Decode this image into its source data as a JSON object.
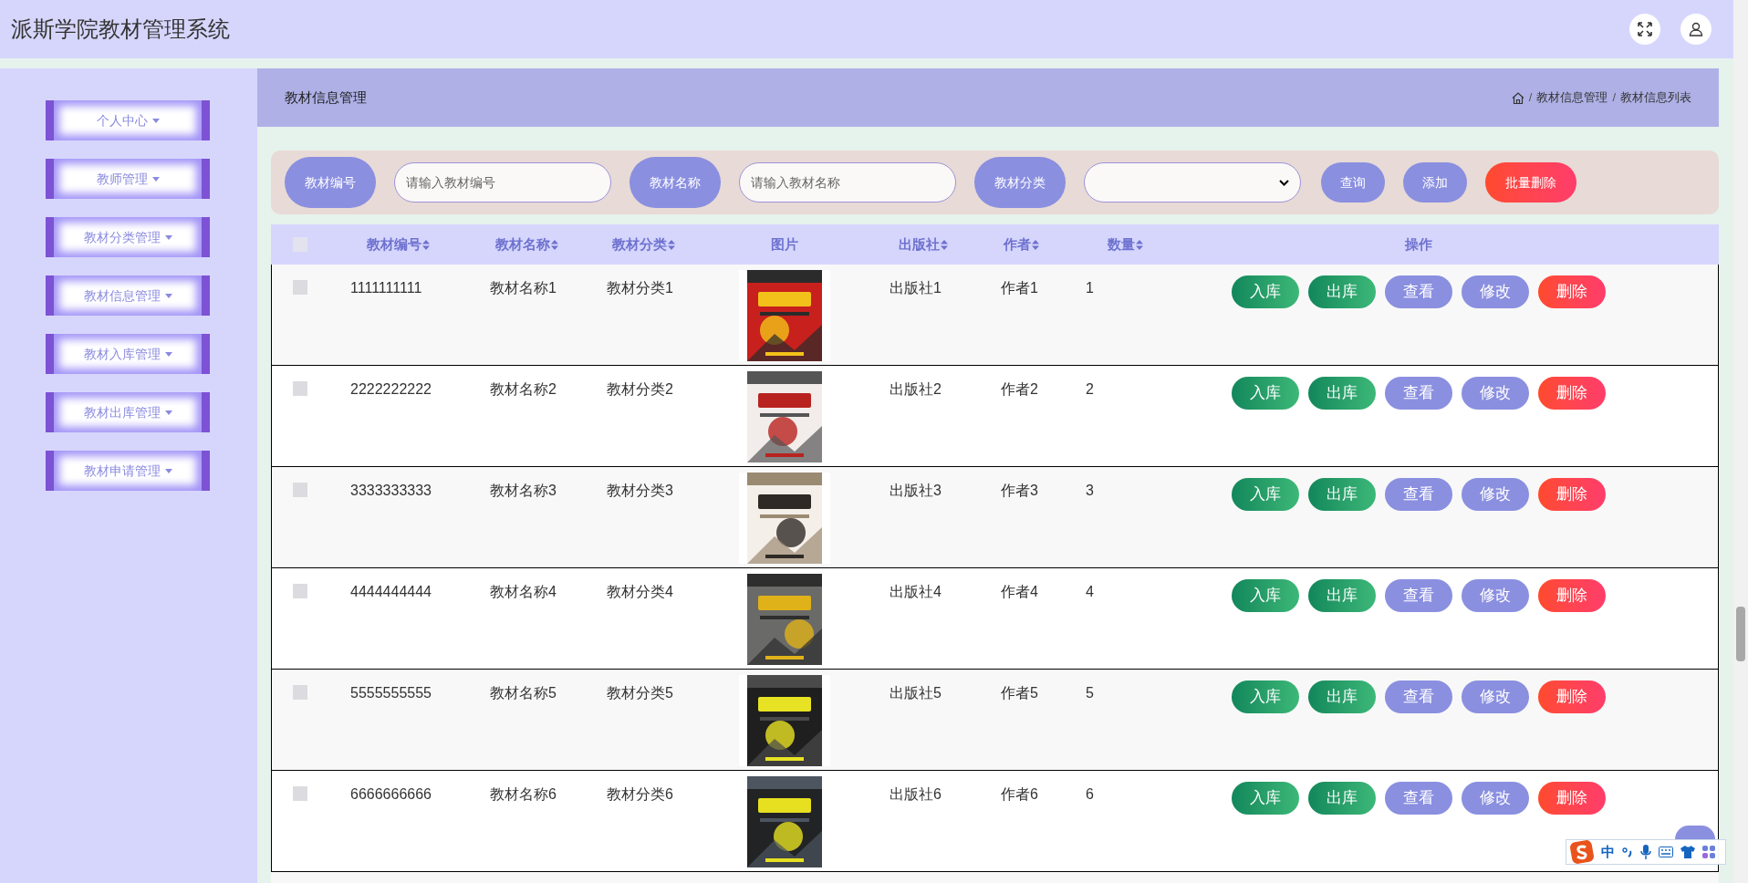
{
  "header": {
    "title": "派斯学院教材管理系统"
  },
  "sidebar": {
    "items": [
      {
        "label": "个人中心"
      },
      {
        "label": "教师管理"
      },
      {
        "label": "教材分类管理"
      },
      {
        "label": "教材信息管理"
      },
      {
        "label": "教材入库管理"
      },
      {
        "label": "教材出库管理"
      },
      {
        "label": "教材申请管理"
      }
    ]
  },
  "page_title": "教材信息管理",
  "breadcrumb": {
    "items": [
      "教材信息管理",
      "教材信息列表"
    ],
    "separators": [
      "/",
      "/"
    ]
  },
  "search": {
    "fields": [
      {
        "label": "教材编号",
        "kind": "input",
        "placeholder": "请输入教材编号"
      },
      {
        "label": "教材名称",
        "kind": "input",
        "placeholder": "请输入教材名称"
      },
      {
        "label": "教材分类",
        "kind": "select"
      }
    ],
    "buttons": [
      {
        "label": "查询",
        "kind": "primary"
      },
      {
        "label": "添加",
        "kind": "primary"
      },
      {
        "label": "批量删除",
        "kind": "danger"
      }
    ]
  },
  "table": {
    "select_all": {
      "checked": false
    },
    "columns": [
      {
        "label": "教材编号",
        "sortable": true
      },
      {
        "label": "教材名称",
        "sortable": true
      },
      {
        "label": "教材分类",
        "sortable": true
      },
      {
        "label": "图片",
        "sortable": false
      },
      {
        "label": "出版社",
        "sortable": true
      },
      {
        "label": "作者",
        "sortable": true
      },
      {
        "label": "数量",
        "sortable": true
      },
      {
        "label": "操作",
        "sortable": false
      }
    ],
    "rows": [
      {
        "checked": false,
        "cells": [
          "1111111111",
          "教材名称1",
          "教材分类1",
          "",
          "出版社1",
          "作者1",
          "1"
        ],
        "actions": [
          {
            "label": "入库",
            "kind": "success"
          },
          {
            "label": "出库",
            "kind": "success"
          },
          {
            "label": "查看",
            "kind": "primary"
          },
          {
            "label": "修改",
            "kind": "primary"
          },
          {
            "label": "删除",
            "kind": "danger"
          }
        ]
      },
      {
        "checked": false,
        "cells": [
          "2222222222",
          "教材名称2",
          "教材分类2",
          "",
          "出版社2",
          "作者2",
          "2"
        ],
        "actions": [
          {
            "label": "入库",
            "kind": "success"
          },
          {
            "label": "出库",
            "kind": "success"
          },
          {
            "label": "查看",
            "kind": "primary"
          },
          {
            "label": "修改",
            "kind": "primary"
          },
          {
            "label": "删除",
            "kind": "danger"
          }
        ]
      },
      {
        "checked": false,
        "cells": [
          "3333333333",
          "教材名称3",
          "教材分类3",
          "",
          "出版社3",
          "作者3",
          "3"
        ],
        "actions": [
          {
            "label": "入库",
            "kind": "success"
          },
          {
            "label": "出库",
            "kind": "success"
          },
          {
            "label": "查看",
            "kind": "primary"
          },
          {
            "label": "修改",
            "kind": "primary"
          },
          {
            "label": "删除",
            "kind": "danger"
          }
        ]
      },
      {
        "checked": false,
        "cells": [
          "4444444444",
          "教材名称4",
          "教材分类4",
          "",
          "出版社4",
          "作者4",
          "4"
        ],
        "actions": [
          {
            "label": "入库",
            "kind": "success"
          },
          {
            "label": "出库",
            "kind": "success"
          },
          {
            "label": "查看",
            "kind": "primary"
          },
          {
            "label": "修改",
            "kind": "primary"
          },
          {
            "label": "删除",
            "kind": "danger"
          }
        ]
      },
      {
        "checked": false,
        "cells": [
          "5555555555",
          "教材名称5",
          "教材分类5",
          "",
          "出版社5",
          "作者5",
          "5"
        ],
        "actions": [
          {
            "label": "入库",
            "kind": "success"
          },
          {
            "label": "出库",
            "kind": "success"
          },
          {
            "label": "查看",
            "kind": "primary"
          },
          {
            "label": "修改",
            "kind": "primary"
          },
          {
            "label": "删除",
            "kind": "danger"
          }
        ]
      },
      {
        "checked": false,
        "cells": [
          "6666666666",
          "教材名称6",
          "教材分类6",
          "",
          "出版社6",
          "作者6",
          "6"
        ],
        "actions": [
          {
            "label": "入库",
            "kind": "success"
          },
          {
            "label": "出库",
            "kind": "success"
          },
          {
            "label": "查看",
            "kind": "primary"
          },
          {
            "label": "修改",
            "kind": "primary"
          },
          {
            "label": "删除",
            "kind": "danger"
          }
        ]
      }
    ]
  },
  "ime_bar": {
    "mode": "中"
  }
}
